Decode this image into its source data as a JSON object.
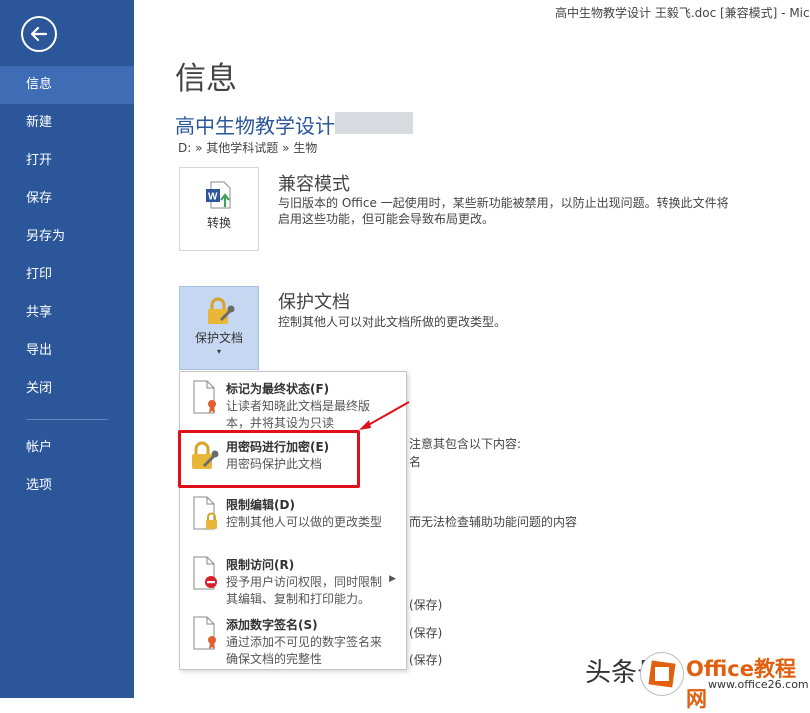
{
  "window": {
    "title": "高中生物教学设计 王毅飞.doc [兼容模式] - Mic"
  },
  "sidebar": {
    "items": [
      {
        "label": "信息",
        "active": true
      },
      {
        "label": "新建"
      },
      {
        "label": "打开"
      },
      {
        "label": "保存"
      },
      {
        "label": "另存为"
      },
      {
        "label": "打印"
      },
      {
        "label": "共享"
      },
      {
        "label": "导出"
      },
      {
        "label": "关闭"
      }
    ],
    "bottom_items": [
      {
        "label": "帐户"
      },
      {
        "label": "选项"
      }
    ],
    "color": "#2b579a"
  },
  "main": {
    "title": "信息",
    "doc_title": "高中生物教学设计",
    "path": "D: » 其他学科试题 » 生物",
    "compat": {
      "tile_label": "转换",
      "heading": "兼容模式",
      "desc_line1": "与旧版本的 Office 一起使用时，某些新功能被禁用，以防止出现问题。转换此文件将",
      "desc_line2": "启用这些功能，但可能会导致布局更改。"
    },
    "protect": {
      "tile_label": "保护文档",
      "heading": "保护文档",
      "desc": "控制其他人可以对此文档所做的更改类型。"
    },
    "background_fragments": {
      "inspect1": "注意其包含以下内容:",
      "inspect2": "名",
      "inspect3": "而无法检查辅助功能问题的内容",
      "save1": "(保存)",
      "save2": "(保存)",
      "save3": "(保存)"
    }
  },
  "menu": {
    "items": [
      {
        "title": "标记为最终状态(F)",
        "desc1": "让读者知晓此文档是最终版",
        "desc2": "本，并将其设为只读"
      },
      {
        "title": "用密码进行加密(E)",
        "desc1": "用密码保护此文档"
      },
      {
        "title": "限制编辑(D)",
        "desc1": "控制其他人可以做的更改类型"
      },
      {
        "title": "限制访问(R)",
        "desc1": "授予用户访问权限，同时限制",
        "desc2": "其编辑、复制和打印能力。"
      },
      {
        "title": "添加数字签名(S)",
        "desc1": "通过添加不可见的数字签名来",
        "desc2": "确保文档的完整性"
      }
    ]
  },
  "watermark": {
    "text": "头条号",
    "brand": "Office教程网",
    "url": "www.office26.com"
  },
  "colors": {
    "accent": "#2b579a",
    "highlight": "#e0101a",
    "tile_active": "#c5d7f1"
  }
}
